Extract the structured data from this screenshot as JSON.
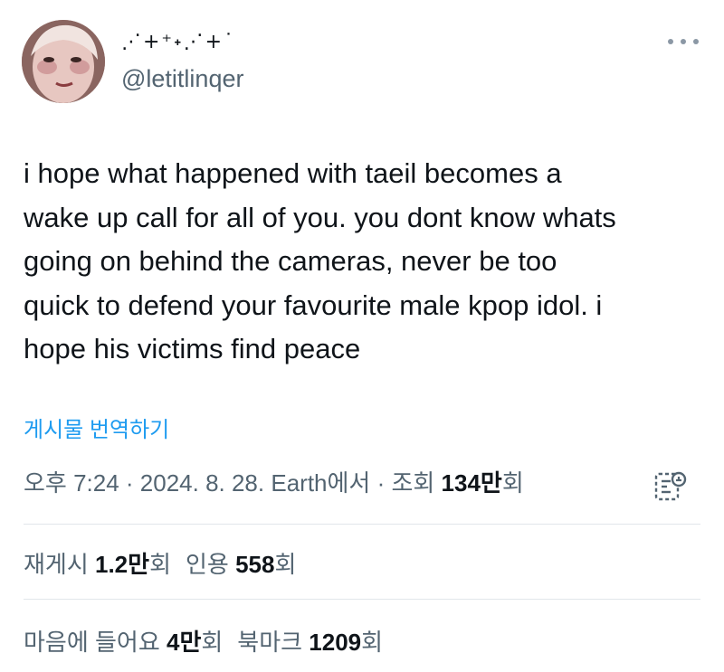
{
  "user": {
    "display_name": "⋰+⁺˖⋰+˙",
    "handle": "@letitlinqer"
  },
  "tweet": {
    "text": "i hope what happened with taeil becomes a\nwake up call for all of you. you dont know whats\ngoing on behind the cameras, never be too\nquick to defend your favourite male kpop idol. i\nhope his victims find peace",
    "translate_label": "게시물 번역하기"
  },
  "meta": {
    "time": "오후 7:24",
    "separator": " · ",
    "date": "2024. 8. 28.",
    "source": "Earth에서",
    "views_label": "조회",
    "views_number": "134만",
    "views_suffix": "회"
  },
  "stats": {
    "retweets": {
      "label": "재게시",
      "number": "1.2만",
      "suffix": "회"
    },
    "quotes": {
      "label": "인용",
      "number": "558",
      "suffix": "회"
    },
    "likes": {
      "label": "마음에 들어요",
      "number": "4만",
      "suffix": "회"
    },
    "bookmarks": {
      "label": "북마크",
      "number": "1209",
      "suffix": "회"
    }
  },
  "icons": {
    "more": "more-horizontal-icon",
    "analytics": "analytics-icon"
  },
  "colors": {
    "link": "#1d9bf0",
    "secondary_text": "#536471",
    "primary_text": "#0f1419",
    "divider": "#e1e6ea"
  }
}
